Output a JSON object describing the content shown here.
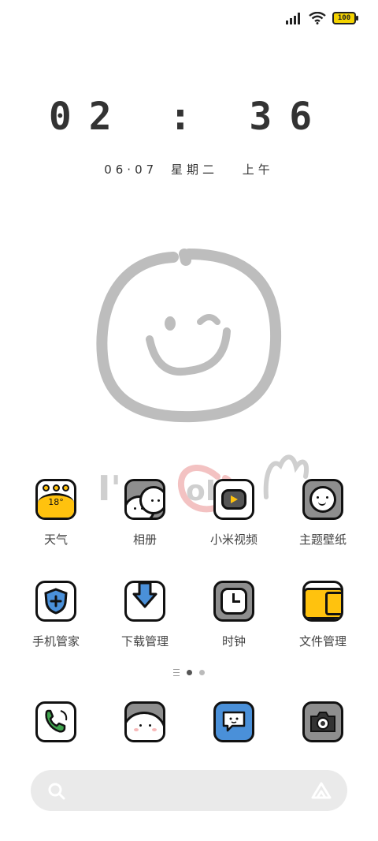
{
  "status_bar": {
    "battery_level": "100"
  },
  "clock": {
    "time": "02 : 36"
  },
  "date": {
    "day": "06·07",
    "weekday": "星期二",
    "period": "上午"
  },
  "apps": [
    {
      "label": "天气",
      "icon": "weather-icon",
      "temp": "18°"
    },
    {
      "label": "相册",
      "icon": "gallery-icon"
    },
    {
      "label": "小米视频",
      "icon": "video-icon"
    },
    {
      "label": "主题壁纸",
      "icon": "themes-icon"
    },
    {
      "label": "手机管家",
      "icon": "security-icon"
    },
    {
      "label": "下载管理",
      "icon": "download-icon"
    },
    {
      "label": "时钟",
      "icon": "clock-icon"
    },
    {
      "label": "文件管理",
      "icon": "file-manager-icon"
    }
  ],
  "page_indicator": {
    "pages": 2,
    "current": 1
  },
  "dock": [
    {
      "icon": "phone-icon"
    },
    {
      "icon": "contacts-icon"
    },
    {
      "icon": "messages-icon"
    },
    {
      "icon": "camera-icon"
    }
  ],
  "search": {
    "icon": "search-icon",
    "assistant_icon": "assistant-icon"
  },
  "colors": {
    "yellow": "#FFC20E",
    "blue": "#4A90D9",
    "green": "#3FA34D",
    "gray": "#8E8E8E"
  }
}
